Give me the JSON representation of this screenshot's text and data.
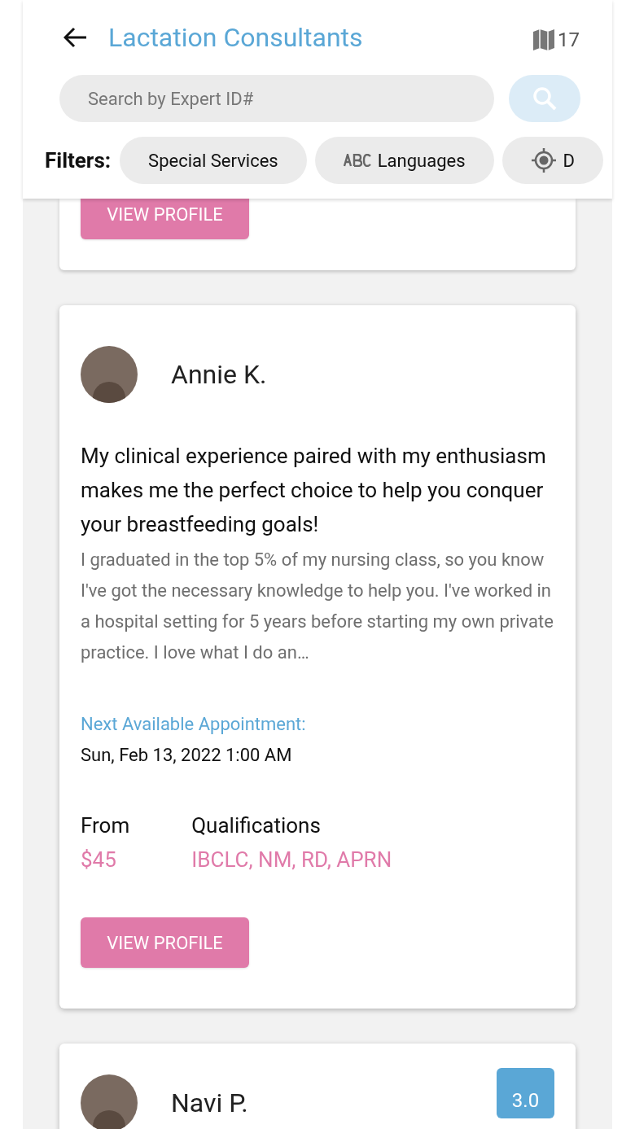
{
  "header": {
    "title": "Lactation Consultants",
    "map_count": "17"
  },
  "search": {
    "placeholder": "Search by Expert ID#"
  },
  "filters": {
    "label": "Filters:",
    "chips": [
      {
        "label": "Special Services",
        "kind": "plain"
      },
      {
        "label": "Languages",
        "kind": "languages"
      },
      {
        "label": "D",
        "kind": "location"
      }
    ]
  },
  "cards": [
    {
      "kind": "partial",
      "button": "VIEW PROFILE"
    },
    {
      "kind": "full",
      "name": "Annie K.",
      "headline": "My clinical experience paired with my enthusiasm makes me the perfect choice to help you conquer your breastfeeding goals!",
      "bio": "I graduated in the top 5% of my nursing class, so you know I've got the necessary knowledge to help you. I've worked in a hospital setting for 5 years before starting my own private practice. I love what I do an…",
      "appointment_label": "Next Available Appointment:",
      "appointment": "Sun, Feb 13, 2022 1:00 AM",
      "price_label": "From",
      "price": "$45",
      "qualifications_label": "Qualifications",
      "qualifications": "IBCLC, NM, RD, APRN",
      "button": "VIEW PROFILE"
    },
    {
      "kind": "top",
      "name": "Navi P.",
      "rating": "3.0"
    }
  ]
}
